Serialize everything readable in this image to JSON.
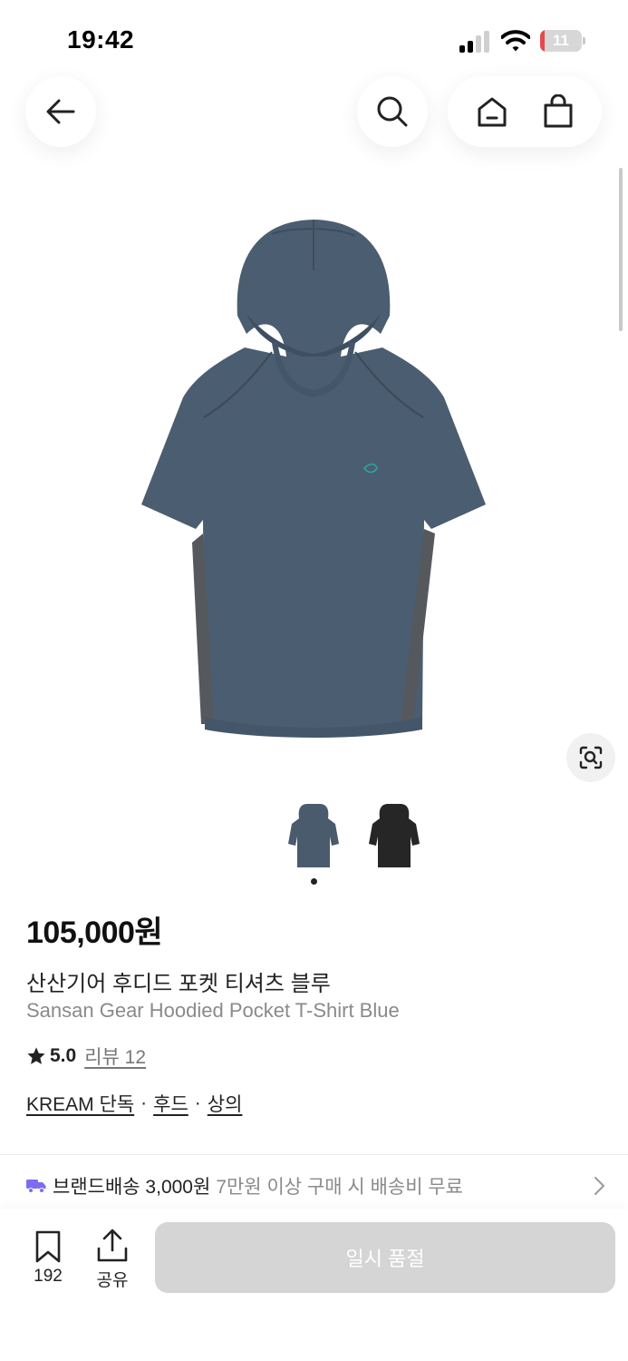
{
  "status_bar": {
    "time": "19:42",
    "battery_level": "11",
    "battery_fraction": 0.11,
    "battery_color": "#e5484d"
  },
  "top_nav": {
    "back_icon": "arrow-left-icon",
    "search_icon": "search-icon",
    "home_icon": "home-icon",
    "cart_icon": "shopping-bag-icon"
  },
  "gallery": {
    "main_image": "navy-blue-hooded-t-shirt",
    "lens_icon": "image-search-icon",
    "thumbnails": [
      {
        "color_name": "blue",
        "color": "#4a5b6e",
        "selected": true
      },
      {
        "color_name": "black",
        "color": "#262626",
        "selected": false
      }
    ],
    "page_count": 1
  },
  "product": {
    "price": "105,000원",
    "name_ko": "산산기어 후디드 포켓 티셔츠 블루",
    "name_en": "Sansan Gear Hoodied Pocket T-Shirt Blue",
    "rating": "5.0",
    "review_label": "리뷰 12",
    "tags": [
      "KREAM 단독",
      "후드",
      "상의"
    ],
    "tag_separator": "·"
  },
  "shipping": {
    "icon": "truck-icon",
    "icon_color": "#7b6cf6",
    "label": "브랜드배송 3,000원",
    "description": "7만원 이상 구매 시 배송비 무료"
  },
  "bottom_bar": {
    "bookmark_icon": "bookmark-icon",
    "bookmark_count": "192",
    "share_icon": "share-icon",
    "share_label": "공유",
    "action_label": "일시 품절"
  }
}
